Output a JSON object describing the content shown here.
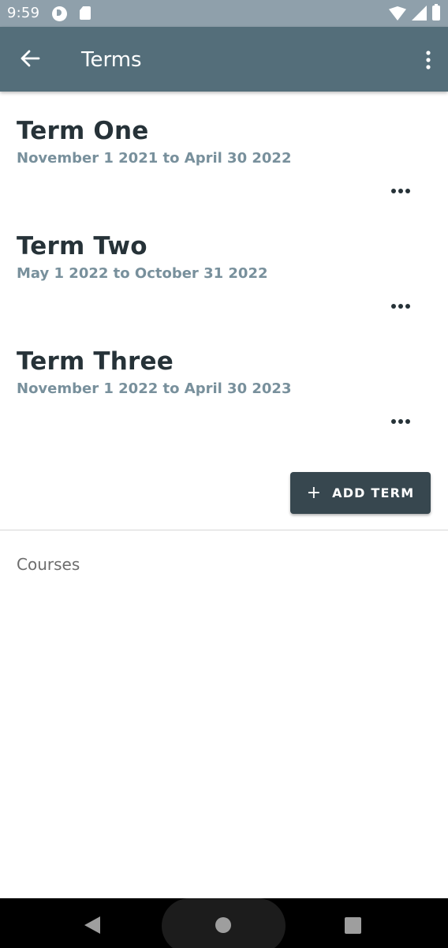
{
  "status_bar": {
    "time": "9:59",
    "icons": [
      "p-app-icon",
      "sd-card-icon",
      "wifi-icon",
      "signal-icon",
      "battery-icon"
    ]
  },
  "app_bar": {
    "title": "Terms",
    "back_icon": "arrow-back-icon",
    "menu_icon": "more-vert-icon"
  },
  "terms": [
    {
      "name": "Term One",
      "dates": "November 1 2021 to April 30 2022"
    },
    {
      "name": "Term Two",
      "dates": "May 1 2022 to October 31 2022"
    },
    {
      "name": "Term Three",
      "dates": "November 1 2022 to April 30 2023"
    }
  ],
  "add_term_button": {
    "icon": "+",
    "label": "ADD TERM"
  },
  "courses_section": {
    "label": "Courses"
  },
  "nav_bar": {
    "icons": [
      "nav-back-icon",
      "nav-home-icon",
      "nav-recents-icon"
    ]
  },
  "colors": {
    "status_bar": "#8fa0ab",
    "app_bar": "#546e7a",
    "button": "#37474f",
    "term_name": "#263238",
    "term_dates": "#78909c"
  }
}
